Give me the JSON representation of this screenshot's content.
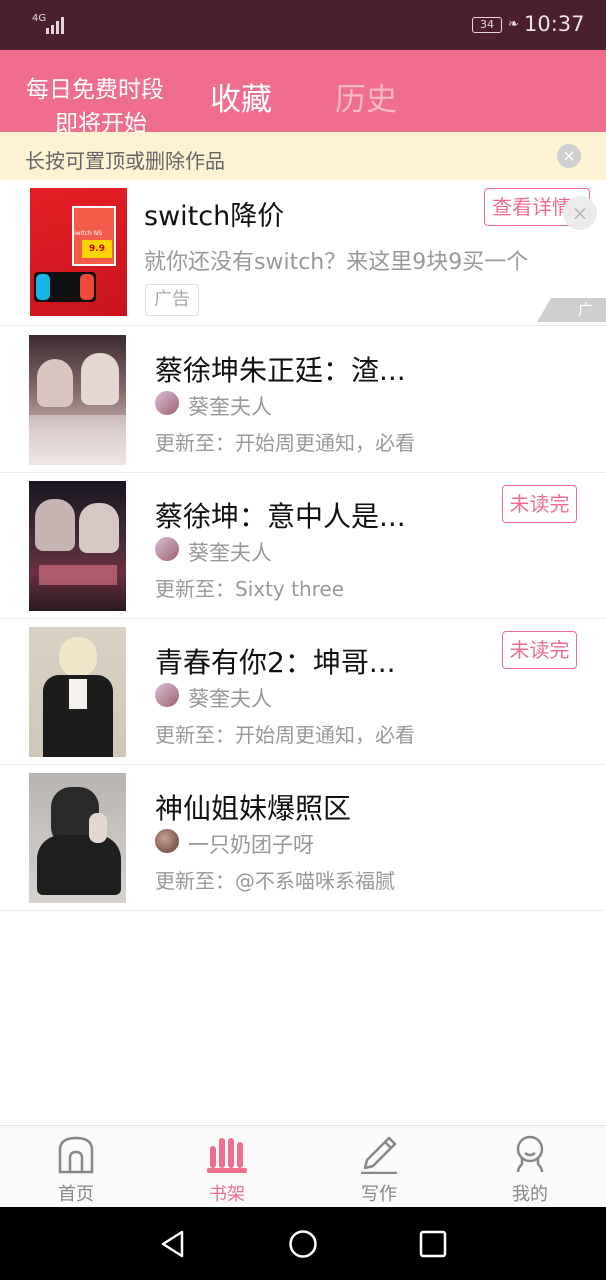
{
  "status_bar": {
    "network": "4G",
    "battery": "34",
    "time": "10:37"
  },
  "header": {
    "promo_line1": "每日免费时段",
    "promo_line2": "即将开始",
    "tabs": [
      {
        "label": "收藏",
        "active": true
      },
      {
        "label": "历史",
        "active": false
      }
    ]
  },
  "tip": {
    "text": "长按可置顶或删除作品",
    "close_icon": "×"
  },
  "ad": {
    "title": "switch降价",
    "button": "查看详情",
    "description": "就你还没有switch？来这里9块9买一个",
    "tag": "广告",
    "corner": "广告",
    "close_icon": "×",
    "image_text": "Switch NS",
    "image_price": "9.9"
  },
  "books": [
    {
      "title": "蔡徐坤朱正廷：渣...",
      "author": "葵奎夫人",
      "update": "更新至：开始周更通知，必看",
      "badge": ""
    },
    {
      "title": "蔡徐坤：意中人是...",
      "author": "葵奎夫人",
      "update": "更新至：Sixty three",
      "badge": "未读完"
    },
    {
      "title": "青春有你2：坤哥...",
      "author": "葵奎夫人",
      "update": "更新至：开始周更通知，必看",
      "badge": "未读完"
    },
    {
      "title": "神仙姐妹爆照区",
      "author": "一只奶团子呀",
      "update": "更新至：@不系喵咪系福腻",
      "badge": ""
    }
  ],
  "bottom_tabs": [
    {
      "label": "首页",
      "icon": "home-icon",
      "active": false
    },
    {
      "label": "书架",
      "icon": "bookshelf-icon",
      "active": true
    },
    {
      "label": "写作",
      "icon": "pencil-icon",
      "active": false
    },
    {
      "label": "我的",
      "icon": "profile-icon",
      "active": false
    }
  ],
  "colors": {
    "accent": "#f06e8d",
    "status_bar": "#4b1f2d",
    "tip_background": "#fdf3d3"
  }
}
